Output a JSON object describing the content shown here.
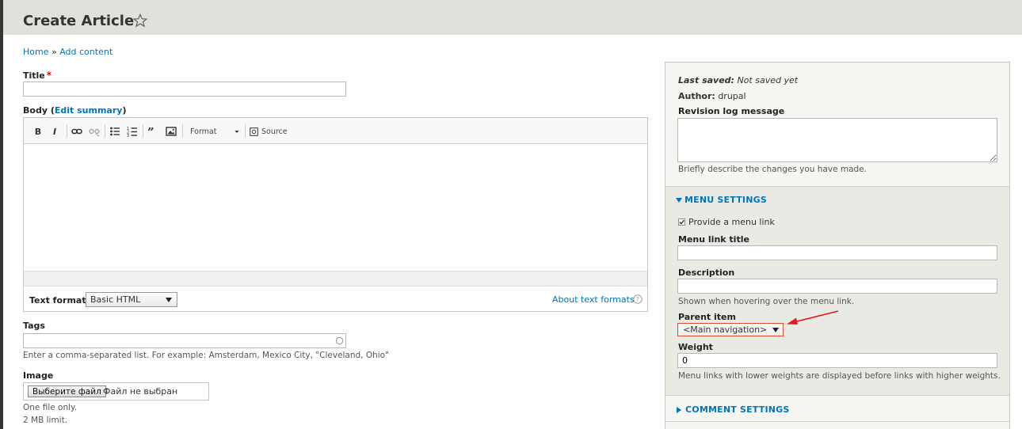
{
  "header": {
    "title": "Create Article"
  },
  "breadcrumb": {
    "home": "Home",
    "separator": "»",
    "add_content": "Add content"
  },
  "form": {
    "title_label": "Title",
    "title_required": "*",
    "title_value": "",
    "body_label": "Body",
    "edit_summary": "Edit summary",
    "toolbar": {
      "bold": "B",
      "italic": "I",
      "format_label": "Format",
      "source_label": "Source"
    },
    "text_format_label": "Text format",
    "text_format_value": "Basic HTML",
    "about_text_formats": "About text formats",
    "tags_label": "Tags",
    "tags_value": "",
    "tags_description": "Enter a comma-separated list. For example: Amsterdam, Mexico City, \"Cleveland, Ohio\"",
    "image_label": "Image",
    "file_button": "Выберите файл",
    "file_status": "Файл не выбран",
    "image_desc_1": "One file only.",
    "image_desc_2": "2 MB limit."
  },
  "sidebar": {
    "last_saved_label": "Last saved:",
    "last_saved_value": "Not saved yet",
    "author_label": "Author:",
    "author_value": "drupal",
    "revision_label": "Revision log message",
    "revision_value": "",
    "revision_description": "Briefly describe the changes you have made.",
    "menu_settings": {
      "title": "Menu settings",
      "provide_link_label": "Provide a menu link",
      "provide_link_checked": true,
      "link_title_label": "Menu link title",
      "link_title_value": "",
      "description_label": "Description",
      "description_value": "",
      "description_help": "Shown when hovering over the menu link.",
      "parent_item_label": "Parent item",
      "parent_item_value": "<Main navigation>",
      "weight_label": "Weight",
      "weight_value": "0",
      "weight_help": "Menu links with lower weights are displayed before links with higher weights."
    },
    "comment_settings": {
      "title": "Comment settings"
    }
  },
  "colors": {
    "link": "#0074bd",
    "header_bg": "#e0e1da",
    "annotation_arrow": "#e8191e"
  }
}
